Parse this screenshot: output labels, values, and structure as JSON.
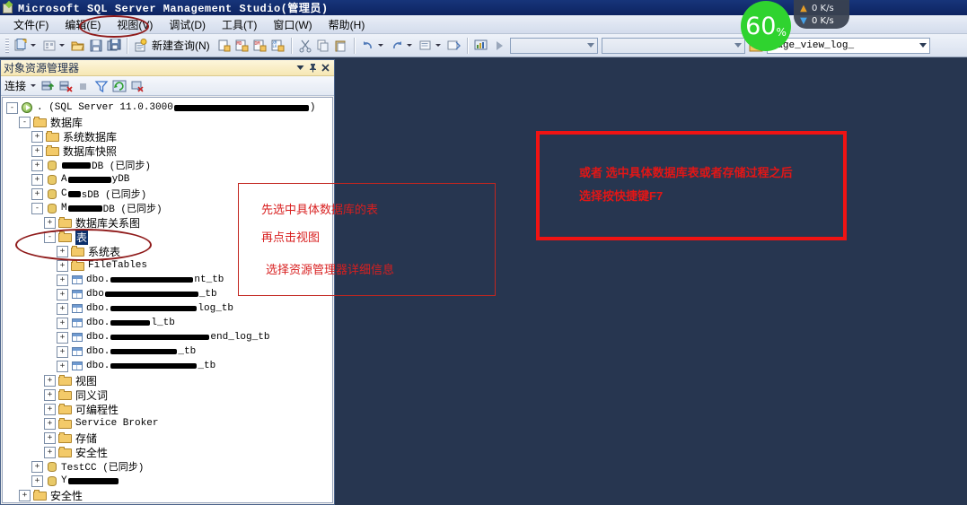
{
  "window": {
    "title": "Microsoft SQL Server Management Studio(管理员)",
    "icon": "ssms-icon"
  },
  "menubar": {
    "items": [
      {
        "label": "文件(F)",
        "name": "menu-file"
      },
      {
        "label": "编辑(E)",
        "name": "menu-edit"
      },
      {
        "label": "视图(V)",
        "name": "menu-view",
        "highlighted": true
      },
      {
        "label": "调试(D)",
        "name": "menu-debug"
      },
      {
        "label": "工具(T)",
        "name": "menu-tools"
      },
      {
        "label": "窗口(W)",
        "name": "menu-window"
      },
      {
        "label": "帮助(H)",
        "name": "menu-help"
      }
    ]
  },
  "toolbar": {
    "new_project_icon": "new-project-icon",
    "new_item_icon": "new-item-icon",
    "open_icon": "open-folder-icon",
    "save_icon": "save-icon",
    "save_all_icon": "save-all-icon",
    "new_query_label": "新建查询(N)",
    "new_query_icon": "new-query-icon",
    "db_engine_query_icon": "database-engine-query-icon",
    "mdx_query_icon": "mdx-query-icon",
    "dmx_query_icon": "dmx-query-icon",
    "xmla_query_icon": "xmla-query-icon",
    "cut_icon": "scissors-icon",
    "copy_icon": "copy-icon",
    "paste_icon": "paste-icon",
    "undo_icon": "undo-icon",
    "redo_icon": "redo-icon",
    "comment_icon": "comment-icon",
    "uncomment_icon": "uncomment-icon",
    "chart_icon": "chart-icon",
    "run_icon": "run-triangle-icon",
    "combo_left_value": "",
    "combo_mid_value": "",
    "registered_servers_icon": "registered-servers-icon",
    "combo_right_value": "page_view_log_"
  },
  "object_explorer": {
    "title": "对象资源管理器",
    "window_menu_icon": "chevron-down-icon",
    "pin_icon": "pin-icon",
    "close_icon": "close-icon",
    "connect_label": "连接",
    "connect_caret_icon": "chevron-down-icon",
    "connect_object_explorer_icon": "connect-icon",
    "disconnect_icon": "disconnect-icon",
    "stop_icon": "stop-icon",
    "filter_icon": "filter-icon",
    "refresh_icon": "refresh-icon",
    "sync_icon": "sync-with-editor-icon",
    "tree": [
      {
        "depth": 0,
        "expander": "-",
        "icon": "server-icon",
        "text": ".  (SQL Server 11.0.3000 ",
        "mono": true,
        "redact": 150,
        "suffix": ")"
      },
      {
        "depth": 1,
        "expander": "-",
        "icon": "folder-icon",
        "text": "数据库"
      },
      {
        "depth": 2,
        "expander": "+",
        "icon": "folder-icon",
        "text": "系统数据库"
      },
      {
        "depth": 2,
        "expander": "+",
        "icon": "folder-icon",
        "text": "数据库快照"
      },
      {
        "depth": 2,
        "expander": "+",
        "icon": "database-icon",
        "text": "",
        "mono": true,
        "redact": 32,
        "suffix": "DB (已同步)"
      },
      {
        "depth": 2,
        "expander": "+",
        "icon": "database-icon",
        "text": "A",
        "mono": true,
        "redact": 48,
        "suffix": "yDB"
      },
      {
        "depth": 2,
        "expander": "+",
        "icon": "database-icon",
        "text": "C",
        "mono": true,
        "redact": 14,
        "suffix": "sDB (已同步)"
      },
      {
        "depth": 2,
        "expander": "-",
        "icon": "database-icon",
        "text": "M",
        "mono": true,
        "redact": 38,
        "suffix": "DB (已同步)"
      },
      {
        "depth": 3,
        "expander": "+",
        "icon": "folder-icon",
        "text": "数据库关系图"
      },
      {
        "depth": 3,
        "expander": "-",
        "icon": "folder-icon",
        "text": "表",
        "selected": true
      },
      {
        "depth": 4,
        "expander": "+",
        "icon": "folder-icon",
        "text": "系统表"
      },
      {
        "depth": 4,
        "expander": "+",
        "icon": "folder-icon",
        "text": "FileTables",
        "mono": true
      },
      {
        "depth": 4,
        "expander": "+",
        "icon": "table-icon",
        "text": "dbo.",
        "mono": true,
        "redact": 92,
        "suffix": "nt_tb"
      },
      {
        "depth": 4,
        "expander": "+",
        "icon": "table-icon",
        "text": "dbo",
        "mono": true,
        "redact": 104,
        "suffix": "_tb"
      },
      {
        "depth": 4,
        "expander": "+",
        "icon": "table-icon",
        "text": "dbo.",
        "mono": true,
        "redact": 96,
        "suffix": "log_tb"
      },
      {
        "depth": 4,
        "expander": "+",
        "icon": "table-icon",
        "text": "dbo.",
        "mono": true,
        "redact": 44,
        "suffix": "l_tb"
      },
      {
        "depth": 4,
        "expander": "+",
        "icon": "table-icon",
        "text": "dbo.",
        "mono": true,
        "redact": 110,
        "suffix": "end_log_tb"
      },
      {
        "depth": 4,
        "expander": "+",
        "icon": "table-icon",
        "text": "dbo.",
        "mono": true,
        "redact": 74,
        "suffix": "_tb"
      },
      {
        "depth": 4,
        "expander": "+",
        "icon": "table-icon",
        "text": "dbo.",
        "mono": true,
        "redact": 96,
        "suffix": "_tb"
      },
      {
        "depth": 3,
        "expander": "+",
        "icon": "folder-icon",
        "text": "视图"
      },
      {
        "depth": 3,
        "expander": "+",
        "icon": "folder-icon",
        "text": "同义词"
      },
      {
        "depth": 3,
        "expander": "+",
        "icon": "folder-icon",
        "text": "可编程性"
      },
      {
        "depth": 3,
        "expander": "+",
        "icon": "folder-icon",
        "text": "Service Broker",
        "mono": true
      },
      {
        "depth": 3,
        "expander": "+",
        "icon": "folder-icon",
        "text": "存储"
      },
      {
        "depth": 3,
        "expander": "+",
        "icon": "folder-icon",
        "text": "安全性"
      },
      {
        "depth": 2,
        "expander": "+",
        "icon": "database-icon",
        "text": "TestCC (已同步)",
        "mono": true
      },
      {
        "depth": 2,
        "expander": "+",
        "icon": "database-icon",
        "text": "Y",
        "mono": true,
        "redact": 56,
        "suffix": ""
      },
      {
        "depth": 1,
        "expander": "+",
        "icon": "folder-icon",
        "text": "安全性"
      }
    ]
  },
  "annotations": {
    "box1": {
      "lines": [
        "先选中具体数据库的表",
        "再点击视图",
        "选择资源管理器详细信息"
      ],
      "color": "#d81f1f"
    },
    "box2": {
      "lines": [
        "或者 选中具体数据库表或者存储过程之后",
        "选择按快捷键F7"
      ],
      "color": "#e21616"
    },
    "ellipse_menu": "highlight-ellipse-view-menu",
    "ellipse_tree": "highlight-ellipse-tables-node"
  },
  "net_widget": {
    "cpu_percent": "60",
    "cpu_unit": "%",
    "upload_arrow": "arrow-up-icon",
    "upload_value": "0 K/s",
    "download_arrow": "arrow-down-icon",
    "download_value": "0 K/s"
  }
}
